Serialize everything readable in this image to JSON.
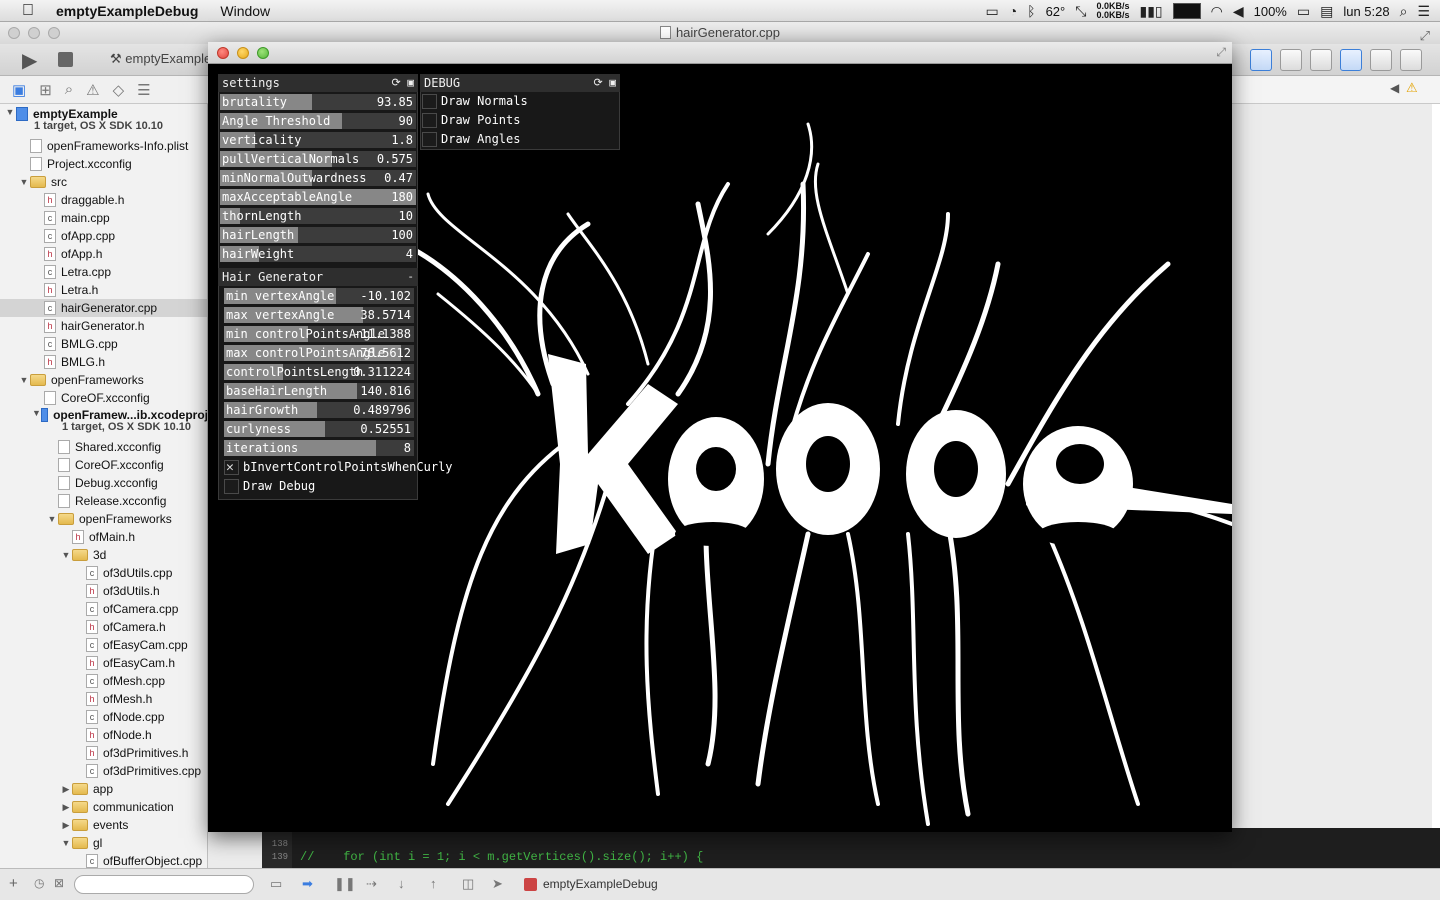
{
  "menubar": {
    "app_name": "emptyExampleDebug",
    "menus": [
      "Window"
    ],
    "temperature": "62°",
    "net_up": "0.0KB/s",
    "net_down": "0.0KB/s",
    "battery": "100%",
    "clock": "lun 5:28"
  },
  "xcode": {
    "window_title": "hairGenerator.cpp",
    "scheme": "emptyExample",
    "navigator": [
      {
        "label": "emptyExample",
        "sub": "1 target, OS X SDK 10.10",
        "type": "proj",
        "indent": 0,
        "disc": "▼",
        "bold": true
      },
      {
        "label": "openFrameworks-Info.plist",
        "type": "cfg",
        "indent": 1
      },
      {
        "label": "Project.xcconfig",
        "type": "cfg",
        "indent": 1
      },
      {
        "label": "src",
        "type": "folder",
        "indent": 1,
        "disc": "▼"
      },
      {
        "label": "draggable.h",
        "type": "h",
        "indent": 2
      },
      {
        "label": "main.cpp",
        "type": "cpp",
        "indent": 2
      },
      {
        "label": "ofApp.cpp",
        "type": "cpp",
        "indent": 2
      },
      {
        "label": "ofApp.h",
        "type": "h",
        "indent": 2
      },
      {
        "label": "Letra.cpp",
        "type": "cpp",
        "indent": 2
      },
      {
        "label": "Letra.h",
        "type": "h",
        "indent": 2
      },
      {
        "label": "hairGenerator.cpp",
        "type": "cpp",
        "indent": 2,
        "selected": true
      },
      {
        "label": "hairGenerator.h",
        "type": "h",
        "indent": 2
      },
      {
        "label": "BMLG.cpp",
        "type": "cpp",
        "indent": 2
      },
      {
        "label": "BMLG.h",
        "type": "h",
        "indent": 2
      },
      {
        "label": "openFrameworks",
        "type": "folder",
        "indent": 1,
        "disc": "▼"
      },
      {
        "label": "CoreOF.xcconfig",
        "type": "cfg",
        "indent": 2
      },
      {
        "label": "openFramew...ib.xcodeproj",
        "sub": "1 target, OS X SDK 10.10",
        "type": "proj",
        "indent": 2,
        "disc": "▼",
        "bold": true
      },
      {
        "label": "Shared.xcconfig",
        "type": "cfg",
        "indent": 3
      },
      {
        "label": "CoreOF.xcconfig",
        "type": "cfg",
        "indent": 3
      },
      {
        "label": "Debug.xcconfig",
        "type": "cfg",
        "indent": 3
      },
      {
        "label": "Release.xcconfig",
        "type": "cfg",
        "indent": 3
      },
      {
        "label": "openFrameworks",
        "type": "folder",
        "indent": 3,
        "disc": "▼"
      },
      {
        "label": "ofMain.h",
        "type": "h",
        "indent": 4
      },
      {
        "label": "3d",
        "type": "folder",
        "indent": 4,
        "disc": "▼"
      },
      {
        "label": "of3dUtils.cpp",
        "type": "cpp",
        "indent": 5
      },
      {
        "label": "of3dUtils.h",
        "type": "h",
        "indent": 5
      },
      {
        "label": "ofCamera.cpp",
        "type": "cpp",
        "indent": 5
      },
      {
        "label": "ofCamera.h",
        "type": "h",
        "indent": 5
      },
      {
        "label": "ofEasyCam.cpp",
        "type": "cpp",
        "indent": 5
      },
      {
        "label": "ofEasyCam.h",
        "type": "h",
        "indent": 5
      },
      {
        "label": "ofMesh.cpp",
        "type": "cpp",
        "indent": 5
      },
      {
        "label": "ofMesh.h",
        "type": "h",
        "indent": 5
      },
      {
        "label": "ofNode.cpp",
        "type": "cpp",
        "indent": 5
      },
      {
        "label": "ofNode.h",
        "type": "h",
        "indent": 5
      },
      {
        "label": "of3dPrimitives.h",
        "type": "h",
        "indent": 5
      },
      {
        "label": "of3dPrimitives.cpp",
        "type": "cpp",
        "indent": 5
      },
      {
        "label": "app",
        "type": "folder",
        "indent": 4,
        "disc": "▶"
      },
      {
        "label": "communication",
        "type": "folder",
        "indent": 4,
        "disc": "▶"
      },
      {
        "label": "events",
        "type": "folder",
        "indent": 4,
        "disc": "▶"
      },
      {
        "label": "gl",
        "type": "folder",
        "indent": 4,
        "disc": "▼"
      },
      {
        "label": "ofBufferObject.cpp",
        "type": "cpp",
        "indent": 5
      }
    ],
    "code_lines": [
      {
        "num": "138",
        "text": ""
      },
      {
        "num": "139",
        "text": "//    for (int i = 1; i < m.getVertices().size(); i++) {"
      }
    ],
    "debug_process": "emptyExampleDebug"
  },
  "of_app": {
    "settings_panel": {
      "title": "settings",
      "sliders": [
        {
          "label": "brutality",
          "value": "93.85",
          "fill": 0.47
        },
        {
          "label": "Angle Threshold",
          "value": "90",
          "fill": 0.62
        },
        {
          "label": "verticality",
          "value": "1.8",
          "fill": 0.18
        },
        {
          "label": "pullVerticalNormals",
          "value": "0.575",
          "fill": 0.57
        },
        {
          "label": "minNormalOutwardness",
          "value": "0.47",
          "fill": 0.47
        },
        {
          "label": "maxAcceptableAngle",
          "value": "180",
          "fill": 1.0
        },
        {
          "label": "thornLength",
          "value": "10",
          "fill": 0.1
        },
        {
          "label": "hairLength",
          "value": "100",
          "fill": 0.4
        },
        {
          "label": "hairWeight",
          "value": "4",
          "fill": 0.2
        }
      ]
    },
    "hair_group": {
      "title": "Hair Generator",
      "collapse": "-",
      "sliders": [
        {
          "label": "min vertexAngle",
          "value": "-10.102",
          "fill": 0.59
        },
        {
          "label": "max vertexAngle",
          "value": "38.5714",
          "fill": 0.73
        },
        {
          "label": "min controlPointsAngle",
          "value": "-11.1388",
          "fill": 0.44
        },
        {
          "label": "max controlPointsAngle",
          "value": "78.5612",
          "fill": 0.93
        },
        {
          "label": "controlPointsLength",
          "value": "0.311224",
          "fill": 0.31
        },
        {
          "label": "baseHairLength",
          "value": "140.816",
          "fill": 0.7
        },
        {
          "label": "hairGrowth",
          "value": "0.489796",
          "fill": 0.49
        },
        {
          "label": "curlyness",
          "value": "0.52551",
          "fill": 0.53
        },
        {
          "label": "iterations",
          "value": "8",
          "fill": 0.8
        }
      ],
      "toggles": [
        {
          "label": "bInvertControlPointsWhenCurly",
          "checked": true
        },
        {
          "label": "Draw Debug",
          "checked": false
        }
      ]
    },
    "debug_panel": {
      "title": "DEBUG",
      "toggles": [
        {
          "label": "Draw Normals",
          "checked": false
        },
        {
          "label": "Draw Points",
          "checked": false
        },
        {
          "label": "Draw Angles",
          "checked": false
        }
      ]
    },
    "artwork_colors": {
      "fg": "#ffffff",
      "bg": "#000000"
    }
  }
}
